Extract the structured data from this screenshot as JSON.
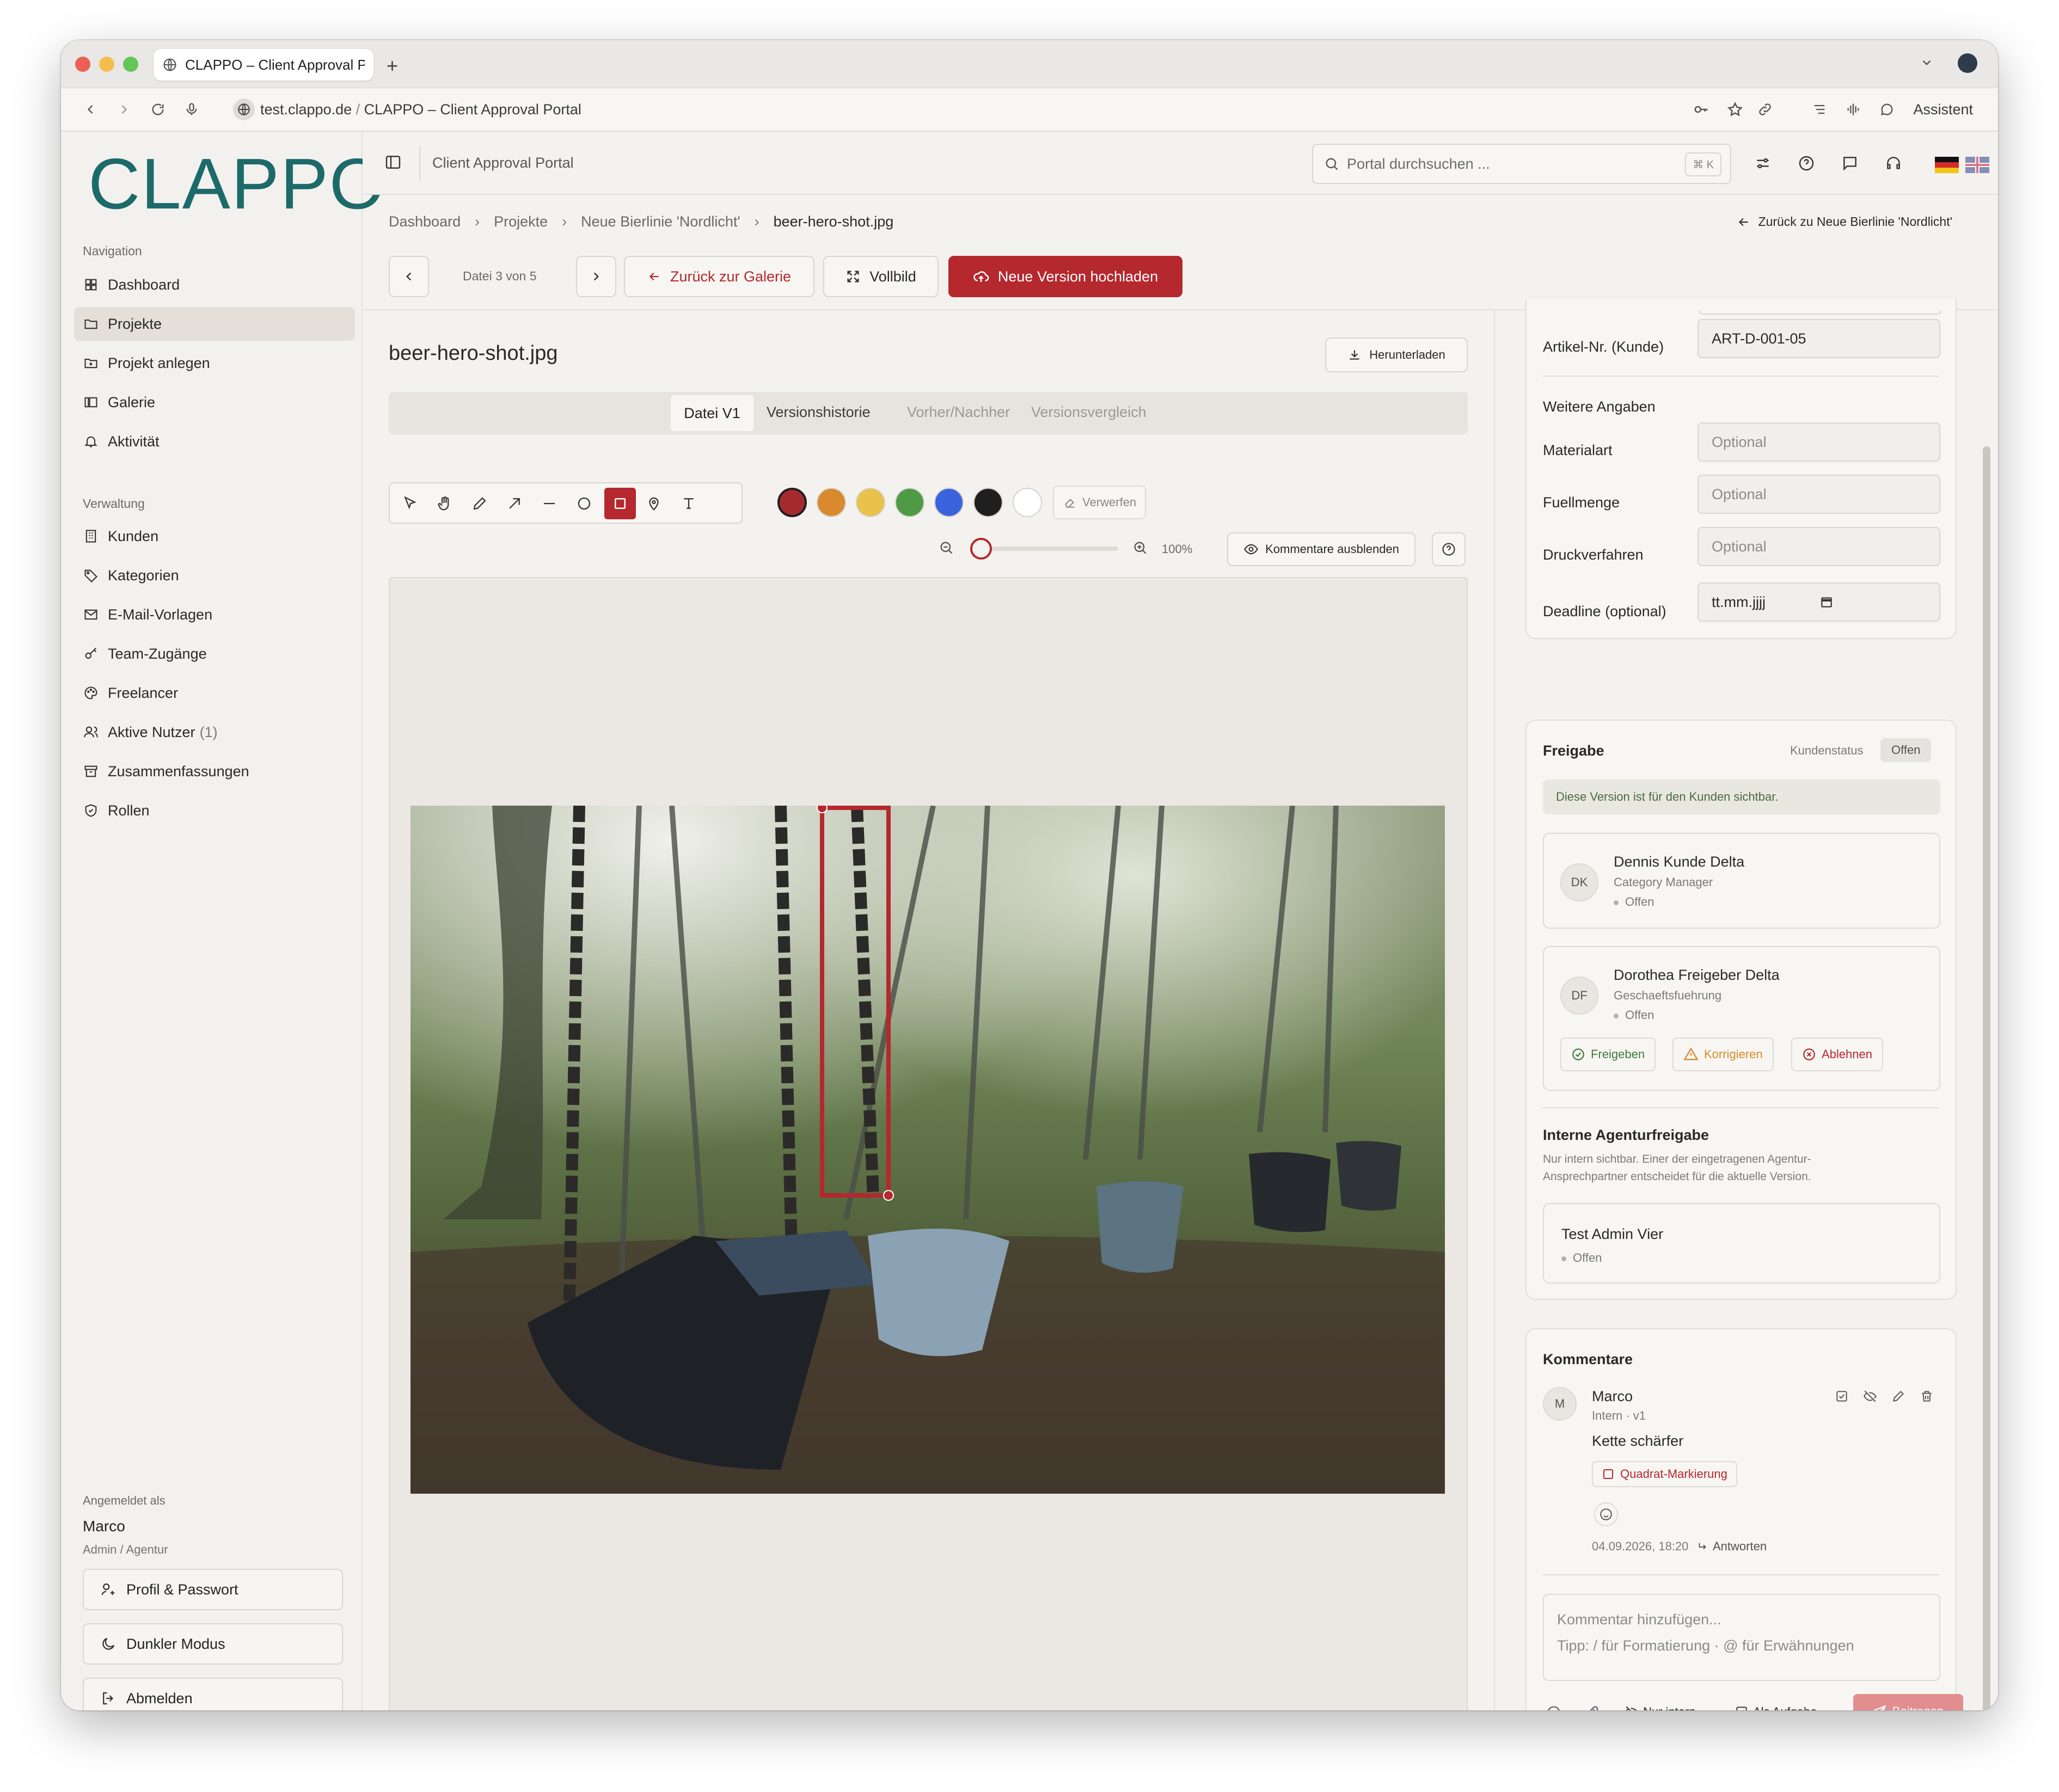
{
  "browser": {
    "tab_title": "CLAPPO – Client Approval P",
    "url_domain": "test.clappo.de",
    "url_sep": "/",
    "url_title": "CLAPPO – Client Approval Portal",
    "assistant_label": "Assistent"
  },
  "sidebar": {
    "logo": "CLAPPO",
    "nav_heading": "Navigation",
    "nav_items": [
      {
        "label": "Dashboard",
        "icon": "dashboard-icon"
      },
      {
        "label": "Projekte",
        "icon": "folder-icon",
        "active": true
      },
      {
        "label": "Projekt anlegen",
        "icon": "folder-plus-icon"
      },
      {
        "label": "Galerie",
        "icon": "gallery-icon"
      },
      {
        "label": "Aktivität",
        "icon": "bell-icon"
      }
    ],
    "admin_heading": "Verwaltung",
    "admin_items": [
      {
        "label": "Kunden",
        "icon": "building-icon"
      },
      {
        "label": "Kategorien",
        "icon": "tag-icon"
      },
      {
        "label": "E-Mail-Vorlagen",
        "icon": "mail-icon"
      },
      {
        "label": "Team-Zugänge",
        "icon": "key-icon"
      },
      {
        "label": "Freelancer",
        "icon": "palette-icon"
      },
      {
        "label": "Aktive Nutzer",
        "count": "(1)",
        "icon": "users-icon"
      },
      {
        "label": "Zusammenfassungen",
        "icon": "archive-icon"
      },
      {
        "label": "Rollen",
        "icon": "shield-icon"
      }
    ],
    "logged_in_as": "Angemeldet als",
    "user_name": "Marco",
    "user_role": "Admin / Agentur",
    "profile_btn": "Profil & Passwort",
    "dark_btn": "Dunkler Modus",
    "logout_btn": "Abmelden"
  },
  "topbar": {
    "title": "Client Approval Portal",
    "search_placeholder": "Portal durchsuchen ...",
    "search_shortcut": "⌘ K"
  },
  "breadcrumb": [
    "Dashboard",
    "Projekte",
    "Neue Bierlinie 'Nordlicht'",
    "beer-hero-shot.jpg"
  ],
  "back_link": "Zurück zu Neue Bierlinie 'Nordlicht'",
  "toolbar": {
    "file_counter": "Datei 3 von 5",
    "back_gallery": "Zurück zur Galerie",
    "fullscreen": "Vollbild",
    "upload": "Neue Version hochladen"
  },
  "file": {
    "name": "beer-hero-shot.jpg",
    "download": "Herunterladen",
    "tabs": [
      "Datei V1",
      "Versionshistorie",
      "Vorher/Nachher",
      "Versionsvergleich"
    ]
  },
  "annotate": {
    "discard": "Verwerfen",
    "zoom": "100%",
    "zoom_fraction": 0.0,
    "hide_comments": "Kommentare ausblenden",
    "colors": [
      "#a52a2e",
      "#d98a2e",
      "#e8c24a",
      "#4e9a45",
      "#3b63de",
      "#1f1f1f",
      "#ffffff"
    ],
    "selected_color": "#a52a2e"
  },
  "details": {
    "article_label": "Artikel-Nr. (Kunde)",
    "article_value": "ART-D-001-05",
    "more_heading": "Weitere Angaben",
    "material_label": "Materialart",
    "fill_label": "Fuellmenge",
    "print_label": "Druckverfahren",
    "optional": "Optional",
    "deadline_label": "Deadline (optional)",
    "deadline_placeholder": "tt.mm.jjjj"
  },
  "approval": {
    "heading": "Freigabe",
    "status_label": "Kundenstatus",
    "status_value": "Offen",
    "notice": "Diese Version ist für den Kunden sichtbar.",
    "approvers": [
      {
        "initials": "DK",
        "name": "Dennis Kunde Delta",
        "role": "Category Manager",
        "status": "Offen"
      },
      {
        "initials": "DF",
        "name": "Dorothea Freigeber Delta",
        "role": "Geschaeftsfuehrung",
        "status": "Offen"
      }
    ],
    "btn_approve": "Freigeben",
    "btn_correct": "Korrigieren",
    "btn_reject": "Ablehnen",
    "internal_heading": "Interne Agenturfreigabe",
    "internal_desc_1": "Nur intern sichtbar. Einer der eingetragenen Agentur-",
    "internal_desc_2": "Ansprechpartner entscheidet für die aktuelle Version.",
    "internal_person": "Test Admin Vier",
    "internal_status": "Offen"
  },
  "comments": {
    "heading": "Kommentare",
    "items": [
      {
        "initial": "M",
        "author": "Marco",
        "meta": "Intern · v1",
        "text": "Kette schärfer",
        "tag": "Quadrat-Markierung",
        "time": "04.09.2026, 18:20",
        "reply": "Antworten"
      }
    ],
    "input_placeholder": "Kommentar hinzufügen...",
    "input_hint": "Tipp: / für Formatierung · @ für Erwähnungen",
    "internal_only": "Nur intern",
    "as_task": "Als Aufgabe",
    "submit": "Beitragen"
  }
}
